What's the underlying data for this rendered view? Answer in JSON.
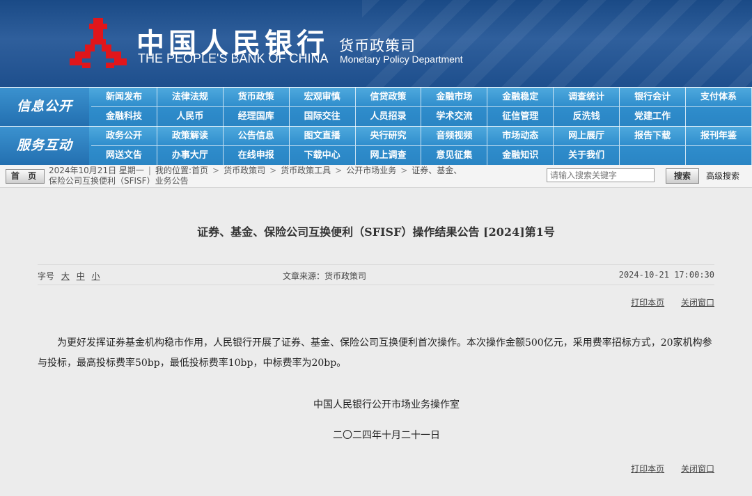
{
  "header": {
    "brand_cn": "中国人民银行",
    "brand_en": "THE PEOPLE'S BANK OF CHINA",
    "dept_cn": "货币政策司",
    "dept_en": "Monetary Policy Department",
    "logo_color": "#e0161b",
    "logo_icon": "pboc-emblem-icon"
  },
  "nav": {
    "info_label": "信息公开",
    "service_label": "服务互动",
    "info_items": [
      "新闻发布",
      "法律法规",
      "货币政策",
      "宏观审慎",
      "信贷政策",
      "金融市场",
      "金融稳定",
      "调查统计",
      "银行会计",
      "支付体系",
      "金融科技",
      "人民币",
      "经理国库",
      "国际交往",
      "人员招录",
      "学术交流",
      "征信管理",
      "反洗钱",
      "党建工作",
      ""
    ],
    "service_items": [
      "政务公开",
      "政策解读",
      "公告信息",
      "图文直播",
      "央行研究",
      "音频视频",
      "市场动态",
      "网上展厅",
      "报告下载",
      "报刊年鉴",
      "网送文告",
      "办事大厅",
      "在线申报",
      "下载中心",
      "网上调查",
      "意见征集",
      "金融知识",
      "关于我们",
      "",
      ""
    ]
  },
  "breadcrumb": {
    "home_label": "首 页",
    "date_text": "2024年10月21日 星期一",
    "location_label": "我的位置:首页",
    "crumbs": [
      "货币政策司",
      "货币政策工具",
      "公开市场业务",
      "证券、基金、"
    ],
    "crumb_tail": "保险公司互换便利（SFISF）业务公告",
    "search_placeholder": "请输入搜索关键字",
    "search_button": "搜索",
    "advanced_search": "高级搜索"
  },
  "article": {
    "title": "证券、基金、保险公司互换便利（SFISF）操作结果公告 [2024]第1号",
    "font_size_label": "字号",
    "font_sizes": [
      "大",
      "中",
      "小"
    ],
    "source": "文章来源：货币政策司",
    "datetime": "2024-10-21 17:00:30",
    "print_label": "打印本页",
    "close_label": "关闭窗口",
    "body": "为更好发挥证券基金机构稳市作用，人民银行开展了证券、基金、保险公司互换便利首次操作。本次操作金额500亿元，采用费率招标方式，20家机构参与投标，最高投标费率50bp，最低投标费率10bp，中标费率为20bp。",
    "signature_org": "中国人民银行公开市场业务操作室",
    "signature_date": "二〇二四年十月二十一日"
  }
}
